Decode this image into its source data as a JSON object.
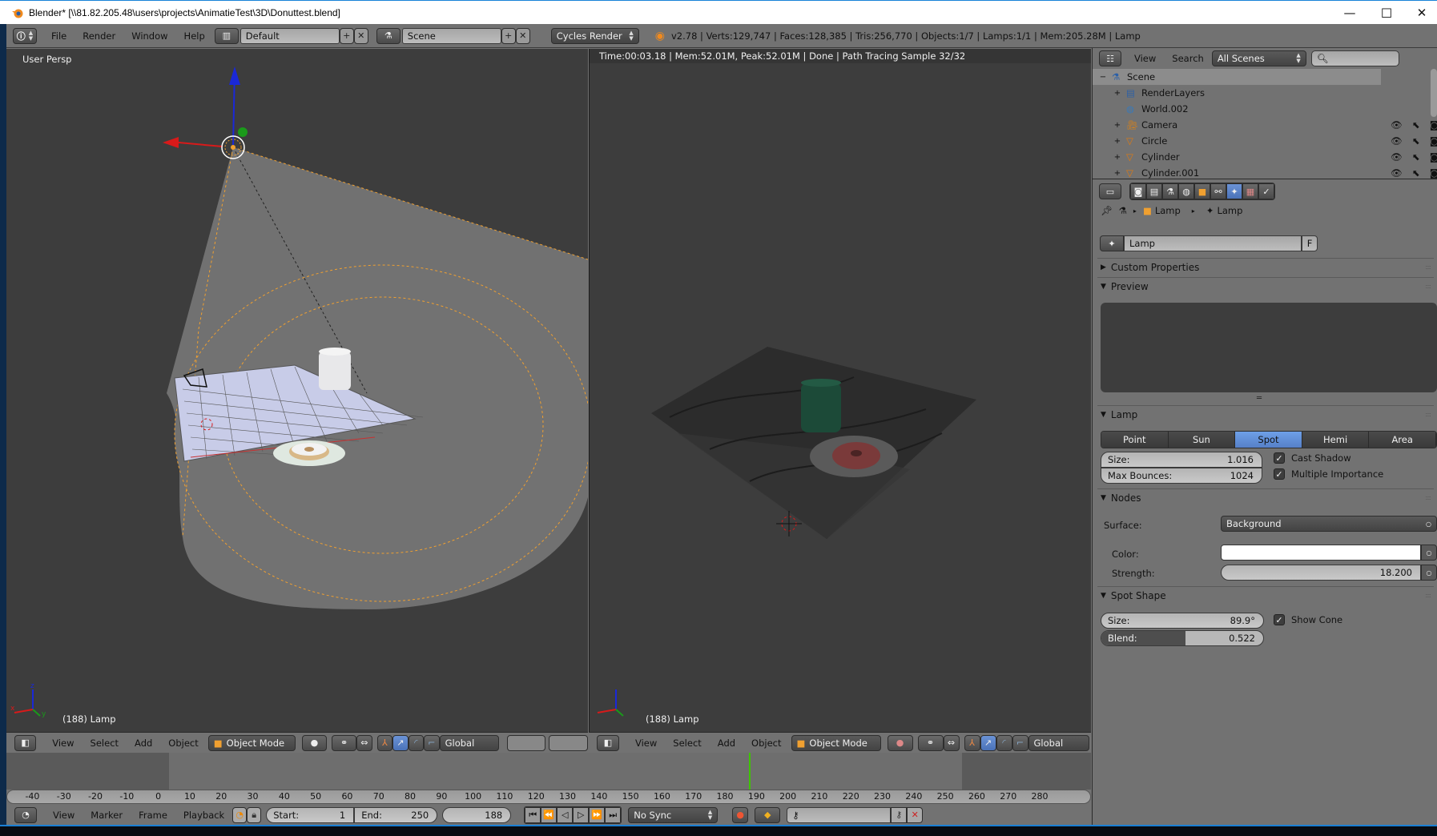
{
  "window": {
    "title": "Blender* [\\\\81.82.205.48\\users\\projects\\AnimatieTest\\3D\\Donuttest.blend]",
    "controls": {
      "minimize": "—",
      "maximize": "☐",
      "close": "✕"
    }
  },
  "info_header": {
    "menus": [
      "File",
      "Render",
      "Window",
      "Help"
    ],
    "layout": "Default",
    "scene": "Scene",
    "render_engine": "Cycles Render",
    "stats": "v2.78 | Verts:129,747 | Faces:128,385 | Tris:256,770 | Objects:1/7 | Lamps:1/1 | Mem:205.28M | Lamp"
  },
  "viewport_left": {
    "view_label": "User Persp",
    "object_label": "(188) Lamp",
    "header": {
      "menus": [
        "View",
        "Select",
        "Add",
        "Object"
      ],
      "mode": "Object Mode",
      "orientation": "Global"
    }
  },
  "viewport_right": {
    "render_status": "Time:00:03.18 | Mem:52.01M, Peak:52.01M | Done | Path Tracing Sample 32/32",
    "object_label": "(188) Lamp",
    "header": {
      "menus": [
        "View",
        "Select",
        "Add",
        "Object"
      ],
      "mode": "Object Mode",
      "orientation": "Global"
    }
  },
  "outliner": {
    "menus": [
      "View",
      "Search"
    ],
    "display_mode": "All Scenes",
    "search_placeholder": "",
    "items": [
      {
        "name": "Scene",
        "icon": "scene-icon",
        "depth": 0,
        "expand": "−"
      },
      {
        "name": "RenderLayers",
        "icon": "render-layers-icon",
        "depth": 1,
        "expand": "+"
      },
      {
        "name": "World.002",
        "icon": "world-icon",
        "depth": 1,
        "expand": ""
      },
      {
        "name": "Camera",
        "icon": "camera-icon",
        "depth": 1,
        "expand": "+"
      },
      {
        "name": "Circle",
        "icon": "mesh-icon",
        "depth": 1,
        "expand": "+"
      },
      {
        "name": "Cylinder",
        "icon": "mesh-icon",
        "depth": 1,
        "expand": "+"
      },
      {
        "name": "Cylinder.001",
        "icon": "mesh-icon",
        "depth": 1,
        "expand": "+"
      }
    ]
  },
  "properties": {
    "breadcrumb": [
      "Lamp",
      "Lamp"
    ],
    "datablock_name": "Lamp",
    "fake_user_label": "F",
    "panels": {
      "custom_properties": "Custom Properties",
      "preview": "Preview",
      "lamp": "Lamp",
      "nodes": "Nodes",
      "spot_shape": "Spot Shape"
    },
    "lamp_types": [
      "Point",
      "Sun",
      "Spot",
      "Hemi",
      "Area"
    ],
    "lamp_type_selected": "Spot",
    "size_label": "Size:",
    "size_value": "1.016",
    "max_bounces_label": "Max Bounces:",
    "max_bounces_value": "1024",
    "cast_shadow_label": "Cast Shadow",
    "cast_shadow": true,
    "multiple_importance_label": "Multiple Importance",
    "multiple_importance": true,
    "surface_label": "Surface:",
    "surface_value": "Background",
    "color_label": "Color:",
    "color_value": "#ffffff",
    "strength_label": "Strength:",
    "strength_value": "18.200",
    "spot_size_label": "Size:",
    "spot_size_value": "89.9°",
    "blend_label": "Blend:",
    "blend_value": "0.522",
    "blend_fraction": 0.522,
    "show_cone_label": "Show Cone",
    "show_cone": true
  },
  "timeline": {
    "ticks": [
      "-40",
      "-30",
      "-20",
      "-10",
      "0",
      "10",
      "20",
      "30",
      "40",
      "50",
      "60",
      "70",
      "80",
      "90",
      "100",
      "110",
      "120",
      "130",
      "140",
      "150",
      "160",
      "170",
      "180",
      "190",
      "200",
      "210",
      "220",
      "230",
      "240",
      "250",
      "260",
      "270",
      "280"
    ],
    "current_frame": 188,
    "header": {
      "menus": [
        "View",
        "Marker",
        "Frame",
        "Playback"
      ],
      "start_label": "Start:",
      "start_value": "1",
      "end_label": "End:",
      "end_value": "250",
      "current_frame_value": "188",
      "sync": "No Sync"
    }
  },
  "colors": {
    "accent_blue": "#5680c8",
    "playhead_green": "#3ec400",
    "selection_orange": "#f0a030"
  }
}
